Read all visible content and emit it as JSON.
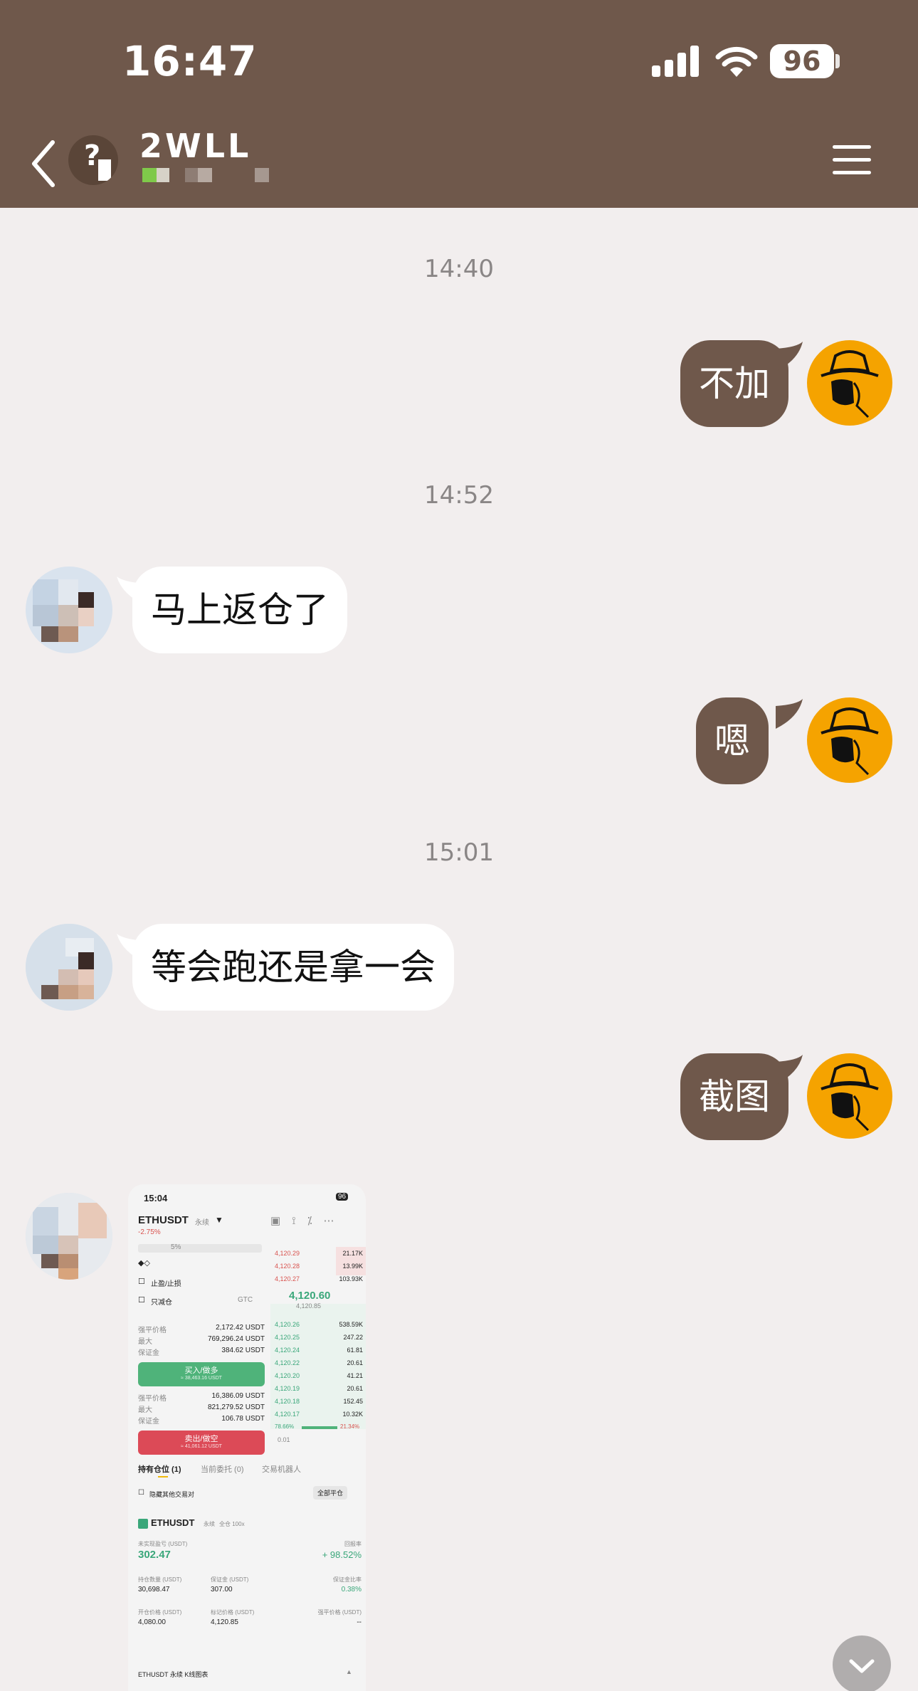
{
  "status_bar": {
    "time": "16:47",
    "battery": "96"
  },
  "header": {
    "name": "2WLL"
  },
  "messages": [
    {
      "type": "time",
      "text": "14:40"
    },
    {
      "type": "out",
      "text": "不加"
    },
    {
      "type": "time",
      "text": "14:52"
    },
    {
      "type": "in",
      "text": "马上返仓了"
    },
    {
      "type": "out",
      "text": "嗯"
    },
    {
      "type": "time",
      "text": "15:01"
    },
    {
      "type": "in",
      "text": "等会跑还是拿一会"
    },
    {
      "type": "out",
      "text": "截图"
    }
  ],
  "screenshot": {
    "status_time": "15:04",
    "status_battery": "96",
    "symbol": "ETHUSDT",
    "contract_type": "永续",
    "change": "-2.75%",
    "leverage_pct": "5%",
    "tp_sl_label": "止盈/止损",
    "reduce_only_label": "只减仓",
    "tif": "GTC",
    "buy_side": {
      "rows": [
        {
          "label": "强平价格",
          "value": "2,172.42 USDT"
        },
        {
          "label": "最大",
          "value": "769,296.24 USDT"
        },
        {
          "label": "保证金",
          "value": "384.62 USDT"
        }
      ],
      "button": "买入/做多",
      "button_sub": "≈ 38,463.16 USDT"
    },
    "sell_side": {
      "rows": [
        {
          "label": "强平价格",
          "value": "16,386.09 USDT"
        },
        {
          "label": "最大",
          "value": "821,279.52 USDT"
        },
        {
          "label": "保证金",
          "value": "106.78 USDT"
        }
      ],
      "button": "卖出/做空",
      "button_sub": "≈ 41,061.12 USDT"
    },
    "asks": [
      {
        "price": "4,120.29",
        "qty": "21.17K"
      },
      {
        "price": "4,120.28",
        "qty": "13.99K"
      },
      {
        "price": "4,120.27",
        "qty": "103.93K"
      }
    ],
    "mid_price": "4,120.60",
    "mark_price": "4,120.85",
    "bids": [
      {
        "price": "4,120.26",
        "qty": "538.59K"
      },
      {
        "price": "4,120.25",
        "qty": "247.22"
      },
      {
        "price": "4,120.24",
        "qty": "61.81"
      },
      {
        "price": "4,120.22",
        "qty": "20.61"
      },
      {
        "price": "4,120.20",
        "qty": "41.21"
      },
      {
        "price": "4,120.19",
        "qty": "20.61"
      },
      {
        "price": "4,120.18",
        "qty": "152.45"
      },
      {
        "price": "4,120.17",
        "qty": "10.32K"
      }
    ],
    "ratio_buy": "78.66%",
    "ratio_sell": "21.34%",
    "depth_step": "0.01",
    "tabs": [
      "持有仓位 (1)",
      "当前委托 (0)",
      "交易机器人"
    ],
    "hide_pairs_label": "隐藏其他交易对",
    "close_all": "全部平仓",
    "position": {
      "symbol": "ETHUSDT",
      "type": "永续",
      "mode": "全仓 100x",
      "pnl_label": "未实现盈亏 (USDT)",
      "roe_label": "回报率",
      "pnl": "302.47",
      "roe": "+ 98.52%",
      "size_label": "持仓数量 (USDT)",
      "margin_label": "保证金 (USDT)",
      "margin_ratio_label": "保证金比率",
      "size": "30,698.47",
      "margin": "307.00",
      "margin_ratio": "0.38%",
      "entry_label": "开仓价格 (USDT)",
      "mark_label": "标记价格 (USDT)",
      "liq_label": "强平价格 (USDT)",
      "entry": "4,080.00",
      "mark": "4,120.85",
      "liq": "--"
    },
    "kline_label": "ETHUSDT 永续 K线图表"
  }
}
